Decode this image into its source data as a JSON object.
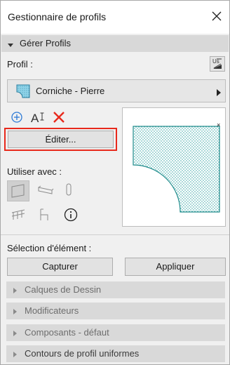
{
  "window": {
    "title": "Gestionnaire de profils",
    "close_icon": "close-icon"
  },
  "manage_section": {
    "title": "Gérer Profils",
    "expanded": true
  },
  "profile": {
    "label": "Profil :",
    "selected": "Corniche - Pierre",
    "fill_color": "#2aa0a0"
  },
  "actions": {
    "new_icon": "plus-circle-icon",
    "rename_icon": "rename-text-icon",
    "delete_icon": "delete-x-icon",
    "edit_label": "Éditer..."
  },
  "use_with": {
    "label": "Utiliser avec :",
    "types": [
      "wall-icon",
      "beam-icon",
      "column-icon",
      "railing-icon",
      "object-icon",
      "info-icon"
    ]
  },
  "element_selection": {
    "label": "Sélection d'élément :",
    "capture_label": "Capturer",
    "apply_label": "Appliquer"
  },
  "collapsed_sections": [
    "Calques de Dessin",
    "Modificateurs",
    "Composants - défaut",
    "Contours de profil uniformes"
  ],
  "colors": {
    "accent_blue": "#2d7ad6",
    "delete_red": "#e8291c",
    "highlight_red": "#e8291c",
    "profile_teal": "#2aa0a0"
  }
}
